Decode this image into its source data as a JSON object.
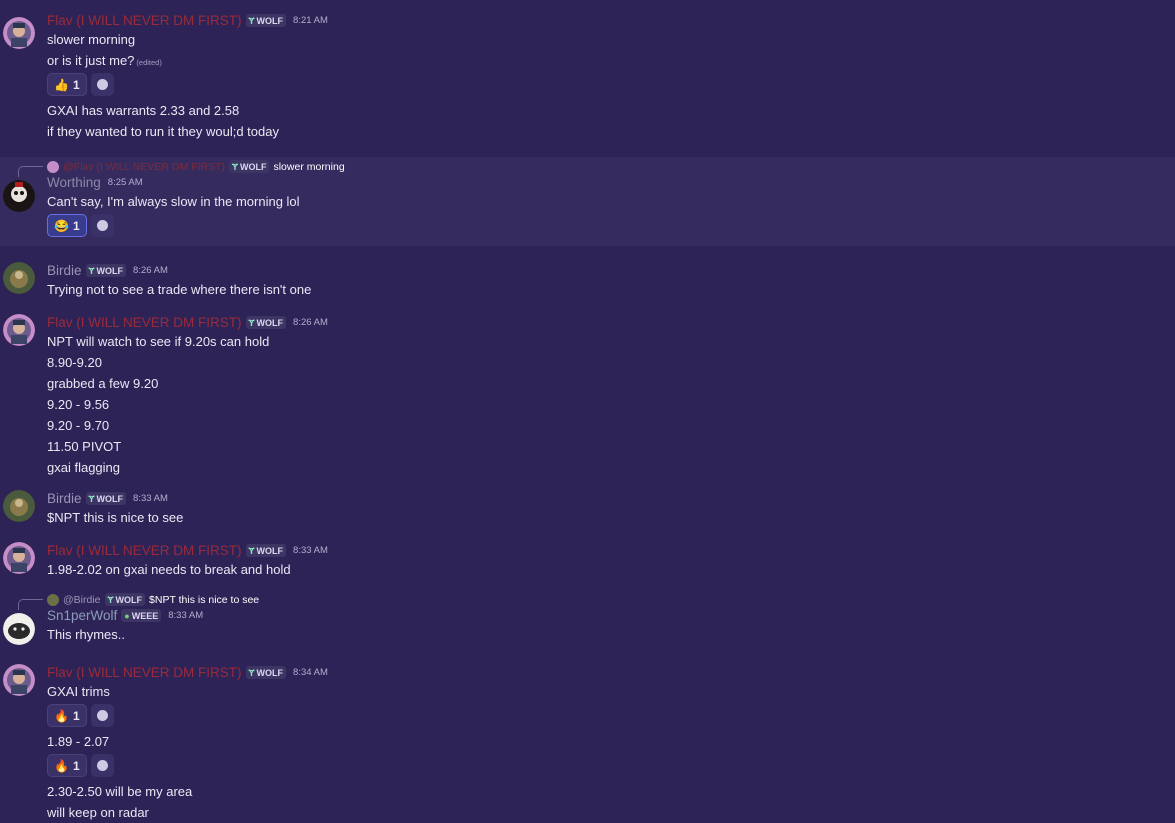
{
  "users": {
    "flav": {
      "name": "Flav (I WILL NEVER DM FIRST)",
      "color": "#9b2a3a"
    },
    "worthing": {
      "name": "Worthing",
      "color": "#8a8aa6"
    },
    "birdie": {
      "name": "Birdie",
      "color": "#9a94b6"
    },
    "sniper": {
      "name": "Sn1perWolf",
      "color": "#8b9cba"
    }
  },
  "tags": {
    "wolf": "WOLF",
    "weee": "WEEE"
  },
  "messages": [
    {
      "time": "8:21 AM",
      "lines": [
        "slower morning",
        "or is it just me?"
      ],
      "edited_label": "(edited)",
      "reaction": {
        "emoji": "👍",
        "count": "1"
      },
      "more_lines": [
        "GXAI has warrants 2.33 and 2.58",
        "if they wanted to run it they woul;d today"
      ]
    },
    {
      "reply": {
        "mention": "@Flav (I WILL NEVER DM FIRST)",
        "tag": "WOLF",
        "text": "slower morning"
      },
      "time": "8:25 AM",
      "lines": [
        "Can't say, I'm always slow in the morning lol"
      ],
      "reaction": {
        "emoji": "😂",
        "count": "1"
      }
    },
    {
      "time": "8:26 AM",
      "lines": [
        "Trying not to see a trade where there isn't one"
      ]
    },
    {
      "time": "8:26 AM",
      "lines": [
        "NPT will watch to see if 9.20s can hold",
        "8.90-9.20",
        "grabbed a few 9.20",
        "9.20 - 9.56",
        "9.20 - 9.70",
        "11.50 PIVOT",
        "gxai flagging"
      ]
    },
    {
      "time": "8:33 AM",
      "lines": [
        "$NPT this is nice to see"
      ]
    },
    {
      "time": "8:33 AM",
      "lines": [
        "1.98-2.02 on gxai needs to break and hold"
      ]
    },
    {
      "reply": {
        "mention": "@Birdie",
        "tag": "WOLF",
        "text": "$NPT this is nice to see"
      },
      "time": "8:33 AM",
      "lines": [
        "This rhymes.."
      ]
    },
    {
      "time": "8:34 AM",
      "lines": [
        "GXAI trims"
      ],
      "reaction": {
        "emoji": "🔥",
        "count": "1"
      },
      "more_lines": [
        "1.89 - 2.07"
      ],
      "reaction2": {
        "emoji": "🔥",
        "count": "1"
      },
      "final_lines": [
        "2.30-2.50 will be my area",
        "will keep on radar"
      ]
    }
  ]
}
